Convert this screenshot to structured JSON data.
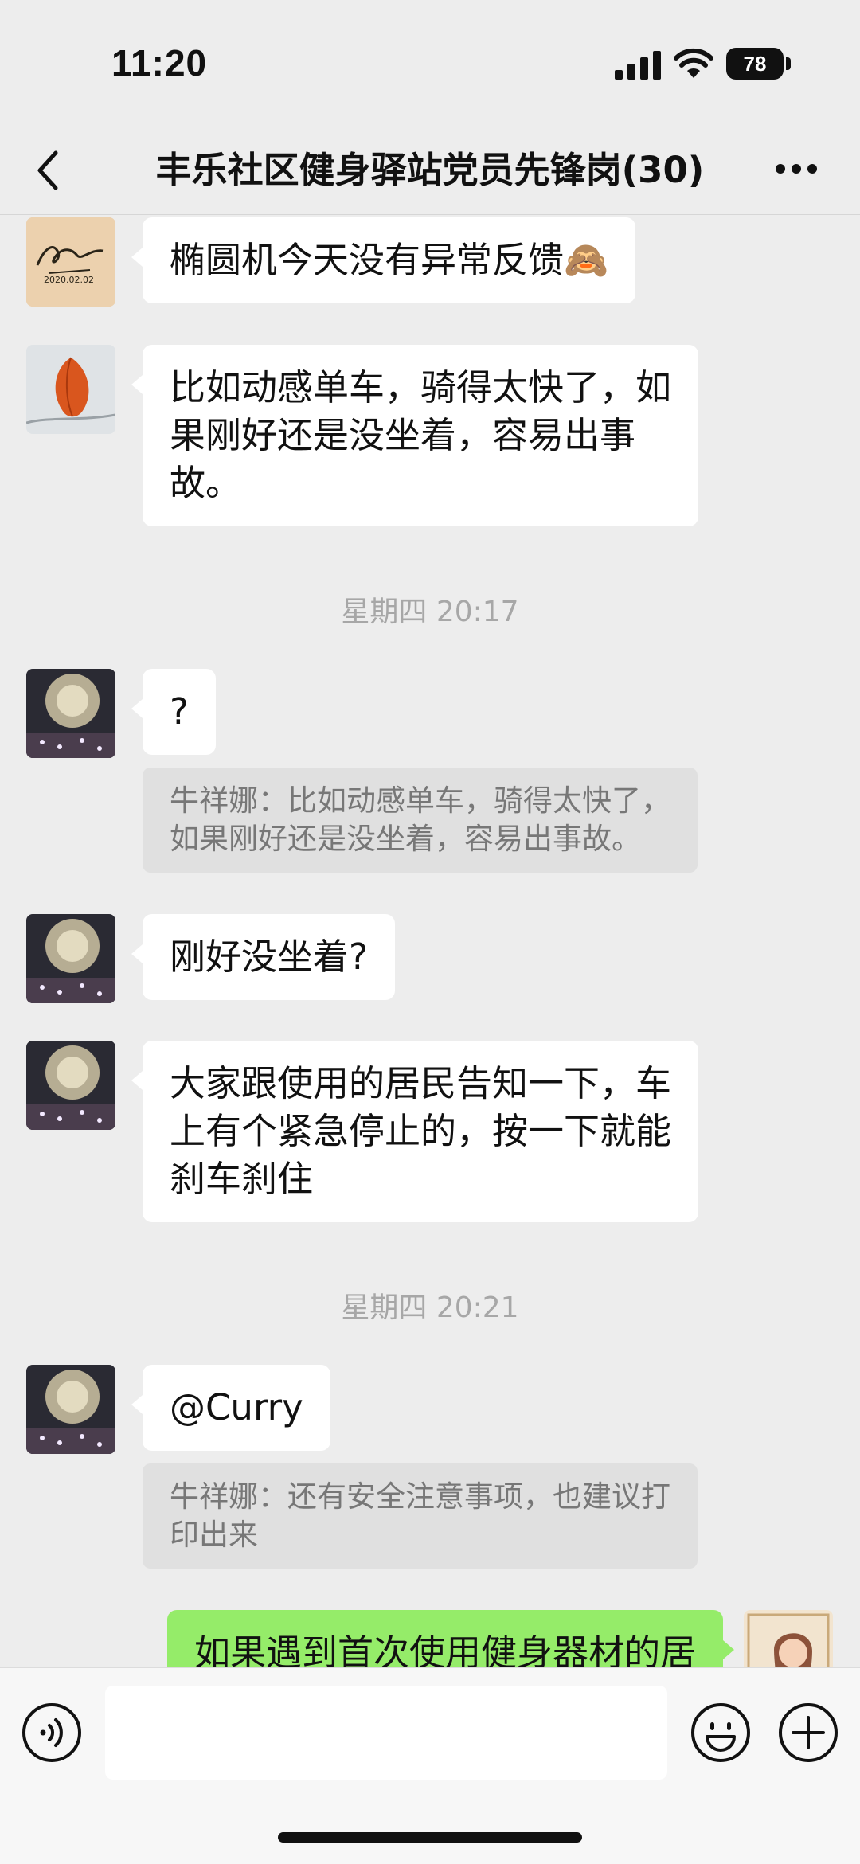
{
  "status_bar": {
    "time": "11:20",
    "battery": "78",
    "icons": [
      "cellular-signal-icon",
      "wifi-icon",
      "battery-icon"
    ]
  },
  "nav": {
    "title": "丰乐社区健身驿站党员先锋岗(30)",
    "back_icon": "chevron-left-icon",
    "more_icon": "ellipsis-icon"
  },
  "messages": [
    {
      "type": "text",
      "text": "椭圆机今天没有异常反馈🙈",
      "avatar": "signature-avatar"
    },
    {
      "type": "text",
      "lines": [
        "比如动感单车，骑得太快了，如",
        "果刚好还是没坐着，容易出事",
        "故。"
      ],
      "avatar": "lantern-flower-avatar"
    },
    {
      "type": "time",
      "text": "星期四 20:17"
    },
    {
      "type": "text",
      "text": "?",
      "avatar": "tree-lights-avatar",
      "quote_lines": [
        "牛祥娜：比如动感单车，骑得太快了，",
        "如果刚好还是没坐着，容易出事故。"
      ]
    },
    {
      "type": "text",
      "text": "刚好没坐着?",
      "avatar": "tree-lights-avatar"
    },
    {
      "type": "text",
      "lines": [
        "大家跟使用的居民告知一下，车",
        "上有个紧急停止的，按一下就能",
        "刹车刹住"
      ],
      "avatar": "tree-lights-avatar"
    },
    {
      "type": "time",
      "text": "星期四 20:21"
    },
    {
      "type": "text",
      "text": "@Curry",
      "avatar": "tree-lights-avatar",
      "quote_lines": [
        "牛祥娜：还有安全注意事项，也建议打",
        "印出来"
      ]
    },
    {
      "type": "text",
      "mine": true,
      "text": "如果遇到首次使用健身器材的居",
      "avatar": "cartoon-girl-avatar"
    }
  ],
  "input_bar": {
    "voice_icon": "voice-icon",
    "input_value": "",
    "emoji_icon": "emoji-icon",
    "plus_icon": "plus-icon"
  },
  "colors": {
    "background": "#ededed",
    "bubble_incoming": "#ffffff",
    "bubble_outgoing": "#95ec69",
    "quote_bg": "#e0e0e0",
    "timestamp_text": "#a7a7a7"
  }
}
